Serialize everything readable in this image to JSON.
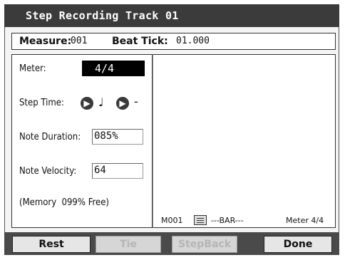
{
  "title": "Step Recording Track 01",
  "measure_bar": {
    "measure_label": "Measure:",
    "measure_value": "001",
    "beat_label": "Beat Tick:",
    "beat_value": "01.000"
  },
  "params": {
    "meter_label": "Meter:",
    "meter_value": "4/4",
    "step_time_label": "Step Time:",
    "step_note_symbol": "♩",
    "step_mod_symbol": "-",
    "note_duration_label": "Note Duration:",
    "note_duration_value": "085%",
    "note_velocity_label": "Note Velocity:",
    "note_velocity_value": "64",
    "memory_text": "(Memory  099% Free)"
  },
  "status": {
    "measure": "M001",
    "bar_text": "---BAR---",
    "meter_text": "Meter 4/4"
  },
  "buttons": {
    "rest": "Rest",
    "tie": "Tie",
    "stepback": "StepBack",
    "done": "Done"
  },
  "icons": {
    "step_time_arrow_1": "arrow-right-circle-icon",
    "step_time_arrow_2": "arrow-right-circle-icon",
    "event_list": "list-icon"
  },
  "colors": {
    "titlebar": "#3b3b3b",
    "selected_value_bg": "#000000",
    "button_bar": "#4a4a4a"
  }
}
